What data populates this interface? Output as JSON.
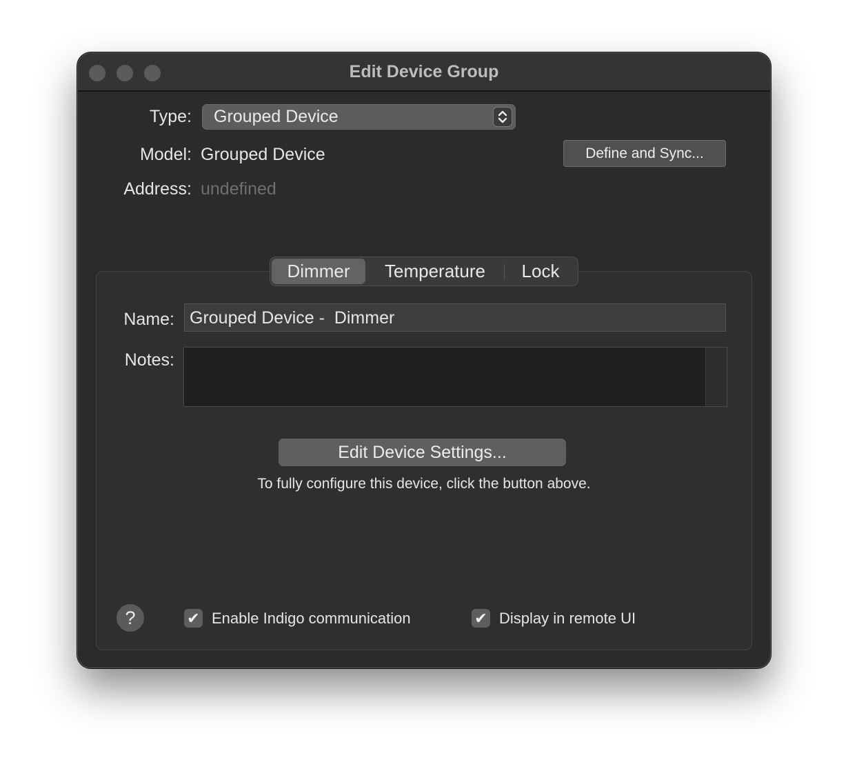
{
  "window": {
    "title": "Edit Device Group"
  },
  "type_row": {
    "label": "Type:",
    "selected": "Grouped Device"
  },
  "model_row": {
    "label": "Model:",
    "value": "Grouped Device"
  },
  "address_row": {
    "label": "Address:",
    "value": "undefined"
  },
  "define_button": "Define and Sync...",
  "tabs": [
    {
      "label": "Dimmer",
      "selected": true
    },
    {
      "label": "Temperature",
      "selected": false
    },
    {
      "label": "Lock",
      "selected": false
    }
  ],
  "name_row": {
    "label": "Name:",
    "value": "Grouped Device -  Dimmer"
  },
  "notes_row": {
    "label": "Notes:",
    "value": ""
  },
  "edit_settings_button": "Edit Device Settings...",
  "hint_text": "To fully configure this device, click the button above.",
  "help_button": "?",
  "checkboxes": [
    {
      "label": "Enable Indigo communication",
      "checked": true
    },
    {
      "label": "Display in remote UI",
      "checked": true
    }
  ],
  "colors": {
    "window_bg": "#2b2b2b",
    "titlebar_bg": "#343434",
    "accent_control": "#5e5e5e",
    "placeholder_text": "#6f6f6f"
  },
  "icons": {
    "popup_stepper": "chevron-up-down-icon",
    "checkmark": "checkmark-icon",
    "help": "question-mark-icon"
  }
}
